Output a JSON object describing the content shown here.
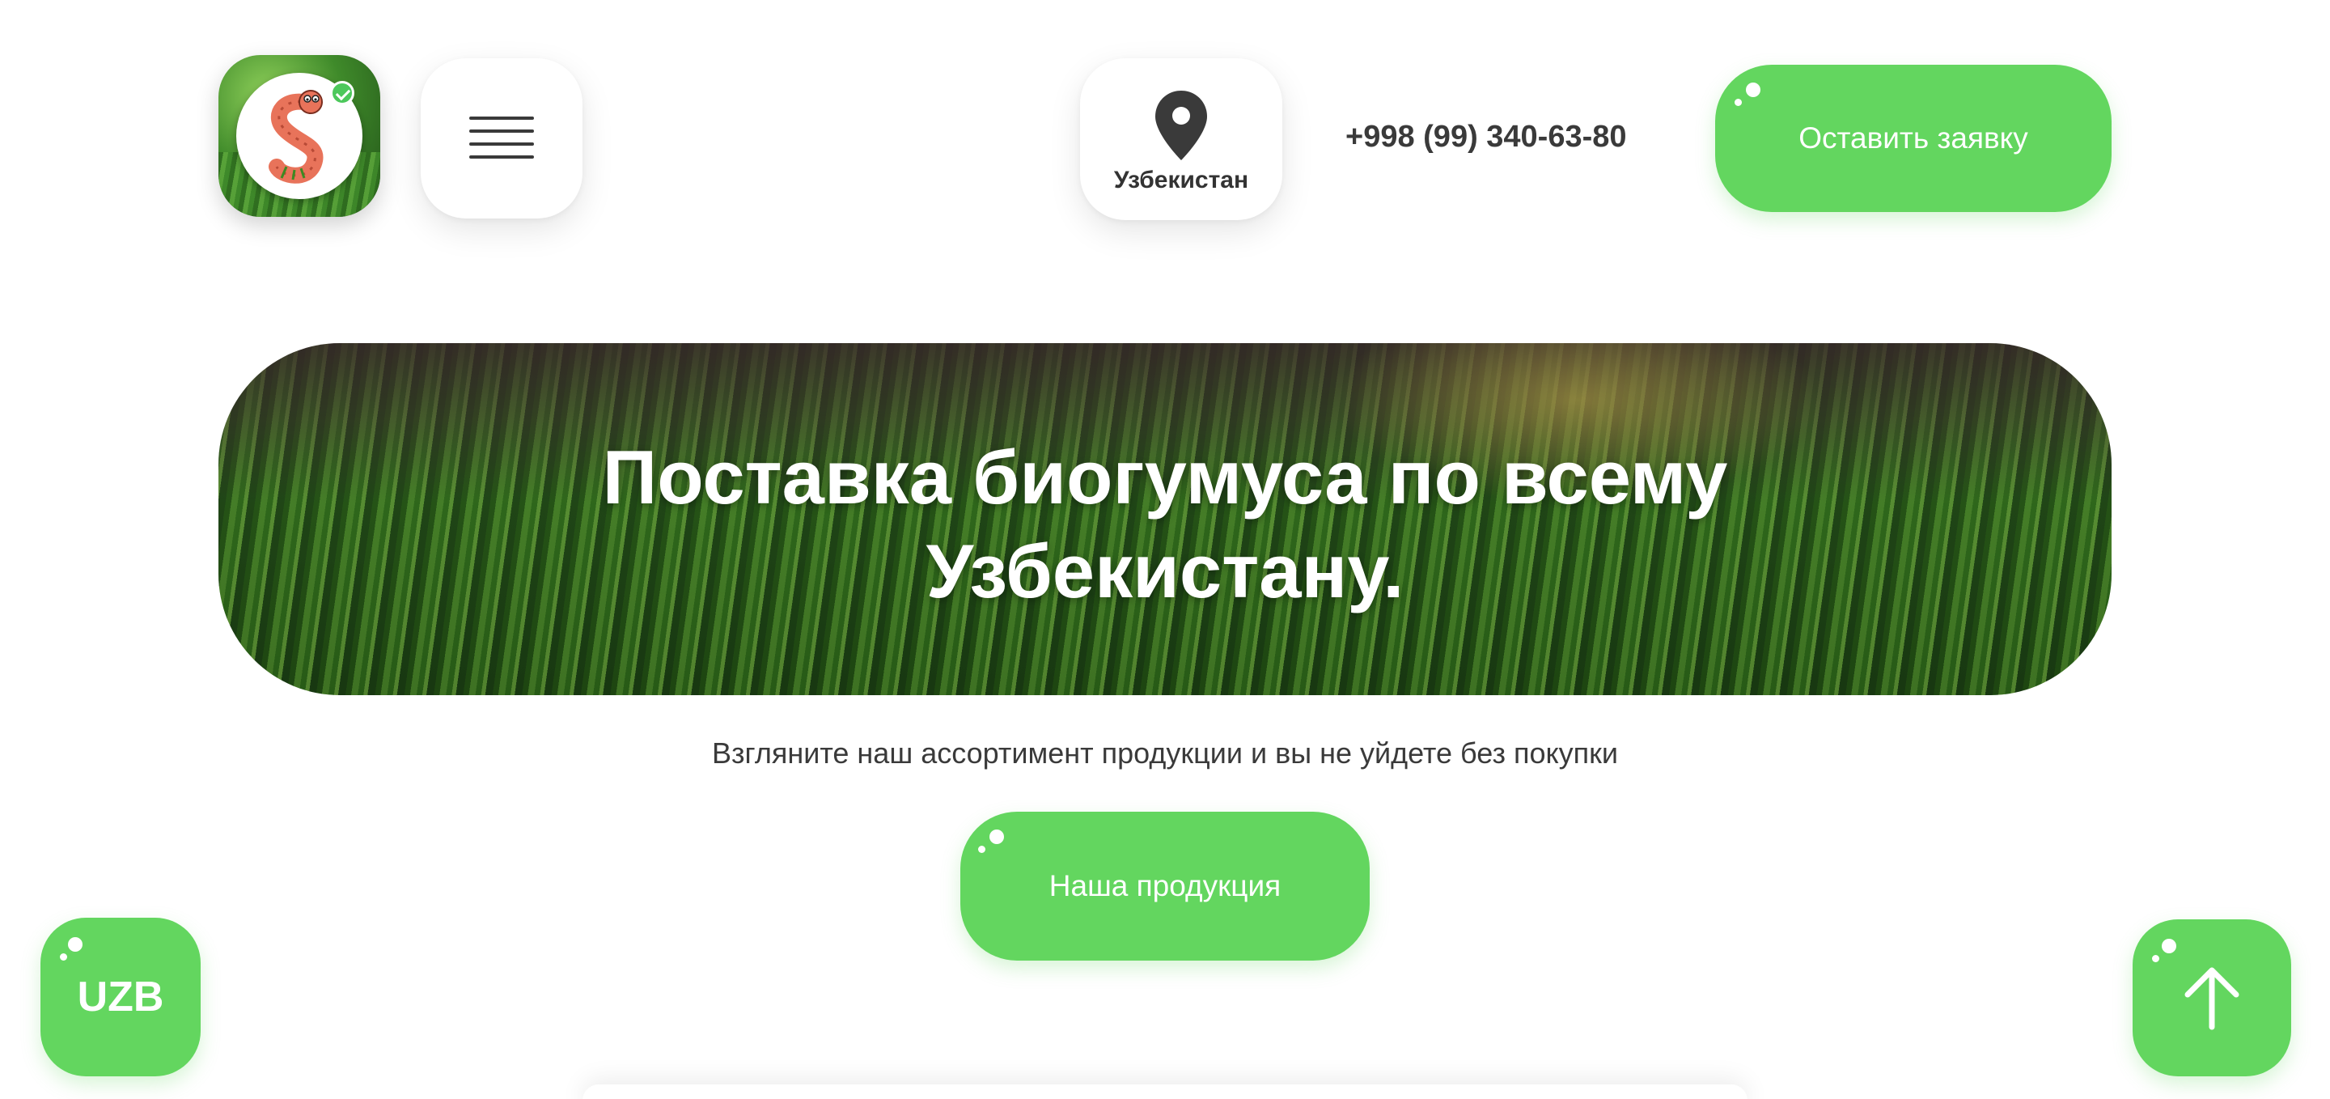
{
  "header": {
    "logo_alt": "Biogumus worm logo",
    "menu_icon": "hamburger-icon",
    "location": {
      "icon": "map-pin-icon",
      "label": "Узбекистан"
    },
    "phone": "+998 (99) 340-63-80",
    "cta_label": "Оставить заявку"
  },
  "hero": {
    "title_line1": "Поставка биогумуса по всему",
    "title_line2": "Узбекистану."
  },
  "main": {
    "subtitle": "Взгляните наш ассортимент продукции и вы не уйдете без покупки",
    "products_button": "Наша продукция"
  },
  "floating": {
    "lang_label": "UZB",
    "scroll_top_icon": "arrow-up-icon"
  },
  "colors": {
    "accent": "#63d65f",
    "text": "#333333",
    "background": "#ffffff"
  }
}
